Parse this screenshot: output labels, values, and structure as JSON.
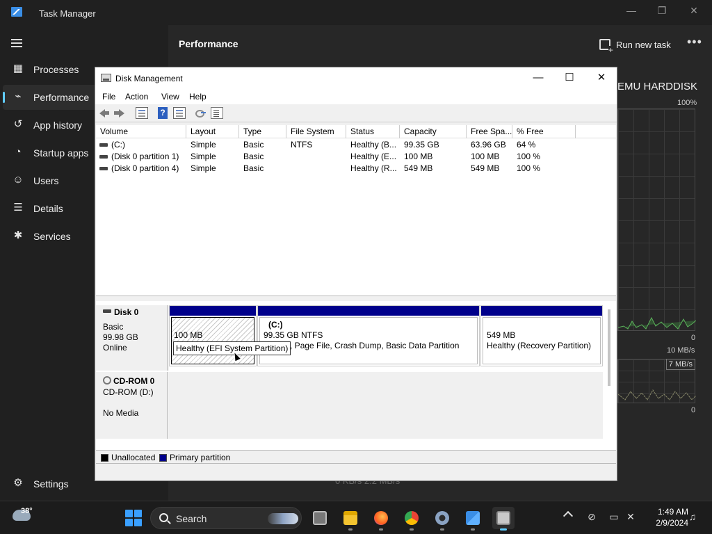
{
  "task_manager": {
    "title": "Task Manager",
    "controls": {
      "minimize": "—",
      "restore": "❐",
      "close": "✕"
    },
    "nav": [
      {
        "label": "Processes",
        "icon": "grid-icon",
        "glyph": "▦"
      },
      {
        "label": "Performance",
        "icon": "pulse-icon",
        "glyph": "⌁",
        "active": true
      },
      {
        "label": "App history",
        "icon": "history-icon",
        "glyph": "↺"
      },
      {
        "label": "Startup apps",
        "icon": "gauge-icon",
        "glyph": "◔"
      },
      {
        "label": "Users",
        "icon": "users-icon",
        "glyph": "☺"
      },
      {
        "label": "Details",
        "icon": "list-icon",
        "glyph": "☰"
      },
      {
        "label": "Services",
        "icon": "puzzle-icon",
        "glyph": "✱"
      }
    ],
    "settings_label": "Settings",
    "settings_glyph": "⚙",
    "header_title": "Performance",
    "run_new_task": "Run new task",
    "more": "•••",
    "disk_title": "EMU HARDDISK",
    "graph1_top": "100%",
    "graph1_bottom": "0",
    "graph2_top": "10 MB/s",
    "graph2_tag": "7 MB/s",
    "graph2_bottom": "0",
    "bottom_stats": "0 KB/s     2.2 MB/s"
  },
  "disk_management": {
    "title": "Disk Management",
    "controls": {
      "minimize": "—",
      "maximize": "☐",
      "close": "✕"
    },
    "menu": [
      "File",
      "Action",
      "View",
      "Help"
    ],
    "toolbar": {
      "help_glyph": "?"
    },
    "columns": [
      "Volume",
      "Layout",
      "Type",
      "File System",
      "Status",
      "Capacity",
      "Free Spa...",
      "% Free"
    ],
    "volumes": [
      [
        "(C:)",
        "Simple",
        "Basic",
        "NTFS",
        "Healthy (B...",
        "99.35 GB",
        "63.96 GB",
        "64 %"
      ],
      [
        "(Disk 0 partition 1)",
        "Simple",
        "Basic",
        "",
        "Healthy (E...",
        "100 MB",
        "100 MB",
        "100 %"
      ],
      [
        "(Disk 0 partition 4)",
        "Simple",
        "Basic",
        "",
        "Healthy (R...",
        "549 MB",
        "549 MB",
        "100 %"
      ]
    ],
    "disk0": {
      "name": "Disk 0",
      "type": "Basic",
      "size": "99.98 GB",
      "state": "Online",
      "partitions": [
        {
          "title": "",
          "size": "100 MB",
          "status": ""
        },
        {
          "title": "(C:)",
          "size": "99.35 GB NTFS",
          "status": "y (Boot, Page File, Crash Dump, Basic Data Partition"
        },
        {
          "title": "",
          "size": "549 MB",
          "status": "Healthy (Recovery Partition)"
        }
      ]
    },
    "cdrom": {
      "name": "CD-ROM 0",
      "drive": "CD-ROM (D:)",
      "media": "No Media"
    },
    "legend": [
      {
        "label": "Unallocated",
        "color": "#000000"
      },
      {
        "label": "Primary partition",
        "color": "#00008b"
      }
    ],
    "tooltip": "Healthy (EFI System Partition)"
  },
  "taskbar": {
    "weather_temp": "38°",
    "search_label": "Search",
    "apps": [
      {
        "name": "task-view-icon",
        "color": "#9a9a9a",
        "active": false
      },
      {
        "name": "file-explorer-icon",
        "color": "#f4c430",
        "active": false
      },
      {
        "name": "firefox-icon",
        "color": "#ff7139",
        "active": false
      },
      {
        "name": "chrome-icon",
        "color": "#34a853",
        "active": false
      },
      {
        "name": "settings-icon",
        "color": "#8aa2c2",
        "active": false
      },
      {
        "name": "task-manager-icon",
        "color": "#3a8ee6",
        "active": false
      },
      {
        "name": "disk-management-icon",
        "color": "#c8c8c8",
        "active": true
      }
    ],
    "time": "1:49 AM",
    "date": "2/9/2024"
  }
}
